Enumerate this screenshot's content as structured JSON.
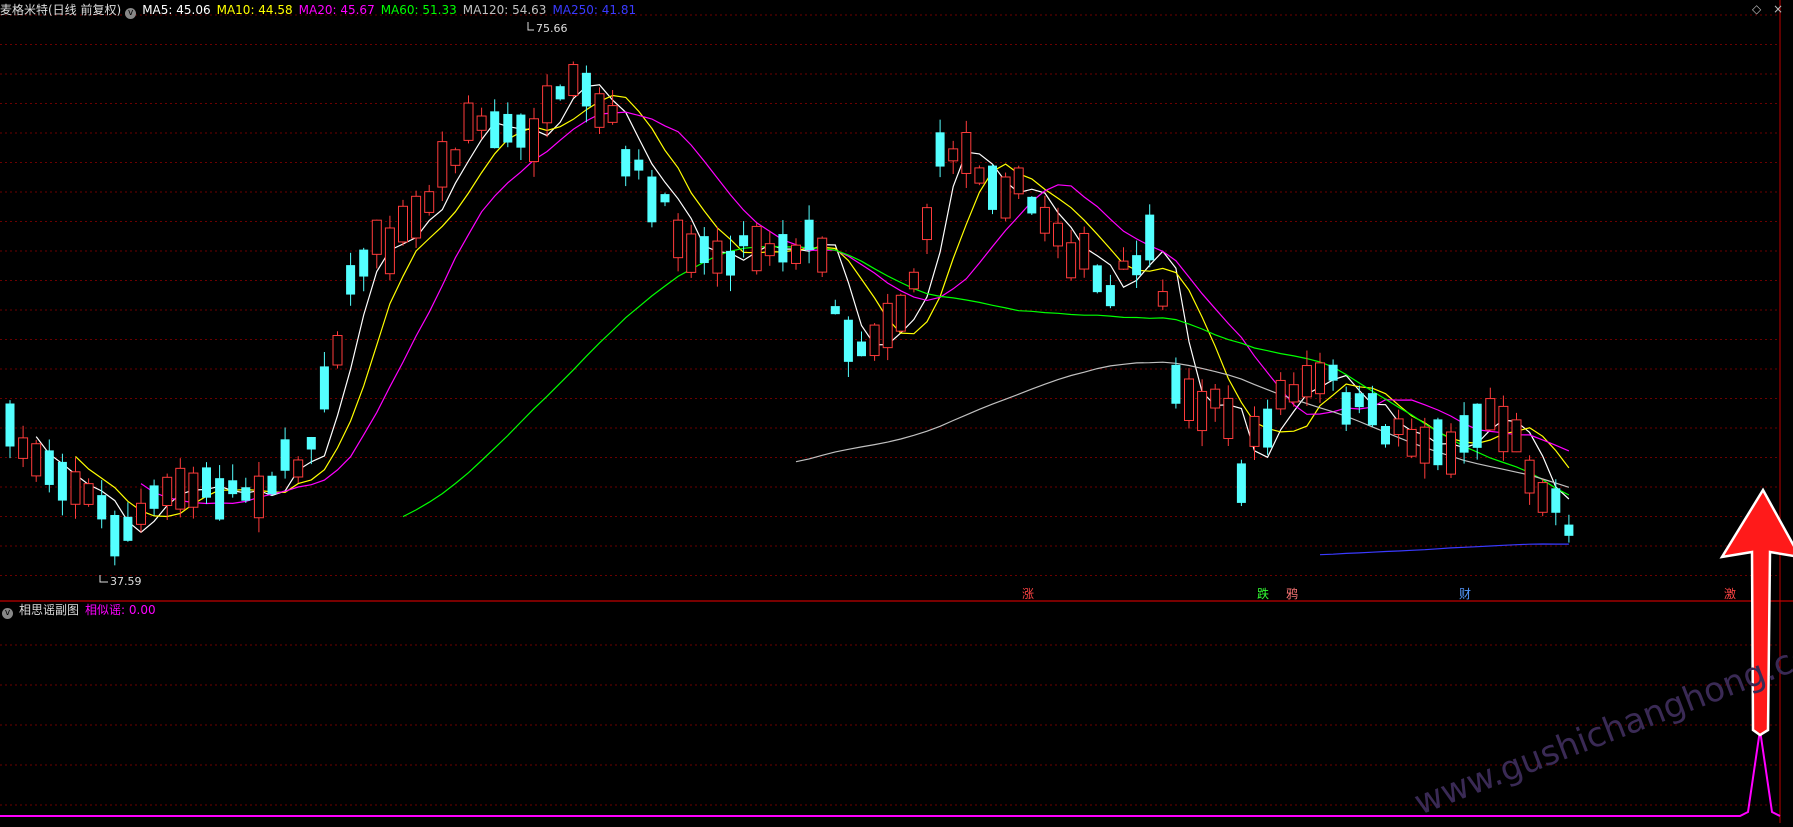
{
  "header": {
    "title": "麦格米特(日线 前复权)",
    "ma": [
      {
        "label": "MA5: 45.06",
        "color": "#ffffff"
      },
      {
        "label": "MA10: 44.58",
        "color": "#ffff00"
      },
      {
        "label": "MA20: 45.67",
        "color": "#ff00ff"
      },
      {
        "label": "MA60: 51.33",
        "color": "#00ff00"
      },
      {
        "label": "MA120: 54.63",
        "color": "#c0c0c0"
      },
      {
        "label": "MA250: 41.81",
        "color": "#3a3aff"
      }
    ]
  },
  "subchart": {
    "title": "相思谣副图",
    "indicator": "相似谣: 0.00",
    "indicator_color": "#ff00ff"
  },
  "colors": {
    "up": "#ff3b3b",
    "down": "#54ffff",
    "grid": "#6b0000",
    "axis": "#c00000"
  },
  "chart_data": {
    "type": "candlestick",
    "annotations": [
      {
        "text": "75.66",
        "kind": "high"
      },
      {
        "text": "37.59",
        "kind": "low"
      }
    ],
    "signals": [
      {
        "text": "涨",
        "color": "#ff4444"
      },
      {
        "text": "跌",
        "color": "#33ff33"
      },
      {
        "text": "鸦",
        "color": "#ff7777"
      },
      {
        "text": "财",
        "color": "#5599ff"
      },
      {
        "text": "激",
        "color": "#ff4444"
      }
    ],
    "watermark": "www.gushichanghong.com"
  }
}
